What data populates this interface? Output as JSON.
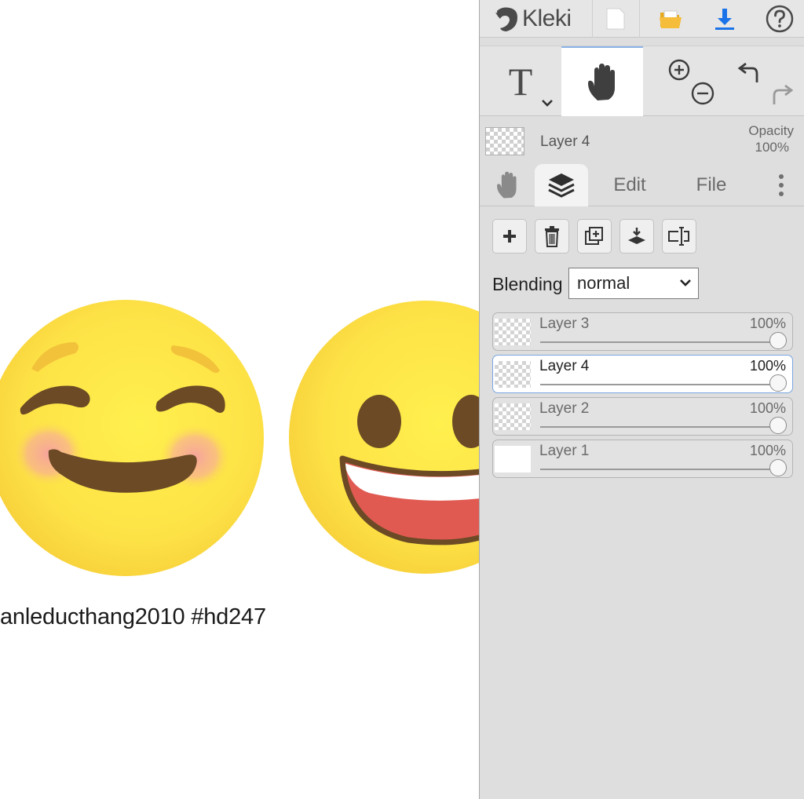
{
  "app": {
    "name": "Kleki"
  },
  "canvas": {
    "caption": "anleducthang2010 #hd247"
  },
  "toolbar": {
    "icons": [
      "new-file-icon",
      "open-folder-icon",
      "download-icon",
      "help-icon"
    ],
    "tools": [
      "text-tool",
      "hand-tool",
      "zoom-in",
      "zoom-out",
      "undo",
      "redo"
    ],
    "text_tool_label": "T"
  },
  "layer_info": {
    "name": "Layer 4",
    "opacity_label": "Opacity",
    "opacity_value": "100%"
  },
  "tabs": {
    "edit": "Edit",
    "file": "File"
  },
  "blending": {
    "label": "Blending",
    "value": "normal"
  },
  "layers": [
    {
      "name": "Layer 3",
      "opacity": "100%",
      "active": false
    },
    {
      "name": "Layer 4",
      "opacity": "100%",
      "active": true
    },
    {
      "name": "Layer 2",
      "opacity": "100%",
      "active": false
    },
    {
      "name": "Layer 1",
      "opacity": "100%",
      "active": false
    }
  ],
  "colors": {
    "accent": "#1a73e8",
    "folder": "#f2b733",
    "emoji_yellow": "#fde84a",
    "mouth_brown": "#6b4a25",
    "tongue_red": "#e05a52"
  }
}
